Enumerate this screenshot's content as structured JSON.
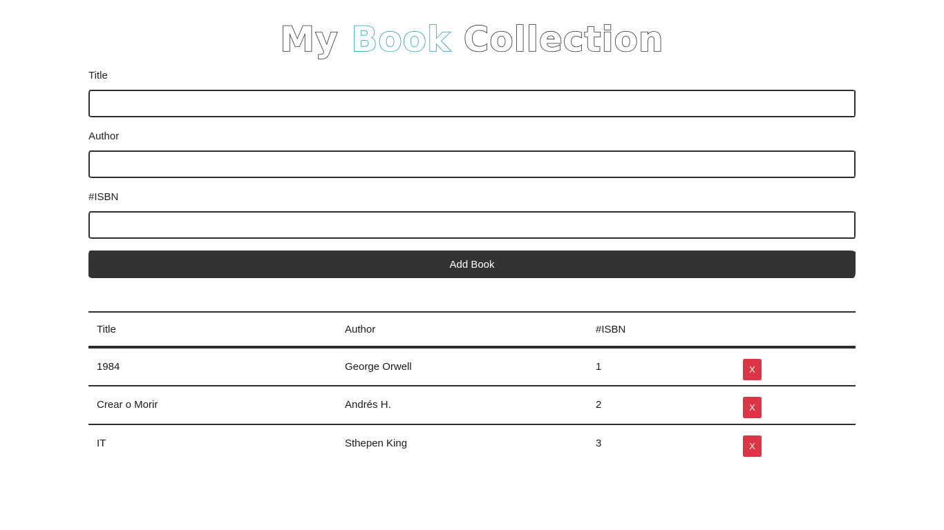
{
  "header": {
    "title_part1": "My",
    "title_part2": "Book",
    "title_part3": "Collection"
  },
  "form": {
    "title_label": "Title",
    "title_value": "",
    "author_label": "Author",
    "author_value": "",
    "isbn_label": "#ISBN",
    "isbn_value": "",
    "submit_label": "Add Book"
  },
  "table": {
    "columns": [
      "Title",
      "Author",
      "#ISBN",
      ""
    ],
    "rows": [
      {
        "title": "1984",
        "author": "George Orwell",
        "isbn": "1",
        "delete_label": "X"
      },
      {
        "title": "Crear o Morir",
        "author": "Andrés H.",
        "isbn": "2",
        "delete_label": "X"
      },
      {
        "title": "IT",
        "author": "Sthepen King",
        "isbn": "3",
        "delete_label": "X"
      }
    ]
  },
  "colors": {
    "accent": "#17a2b8",
    "button_dark": "#333333",
    "danger": "#dc3545"
  }
}
